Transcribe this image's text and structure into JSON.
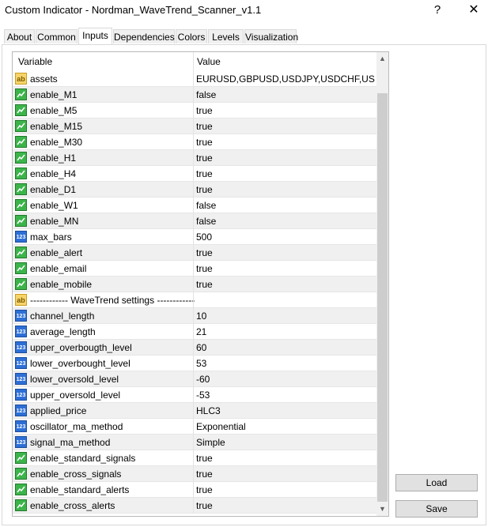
{
  "window": {
    "title": "Custom Indicator - Nordman_WaveTrend_Scanner_v1.1",
    "help_glyph": "?",
    "close_glyph": "✕"
  },
  "tabs": [
    "About",
    "Common",
    "Inputs",
    "Dependencies",
    "Colors",
    "Levels",
    "Visualization"
  ],
  "active_tab": "Inputs",
  "grid": {
    "header": {
      "variable": "Variable",
      "value": "Value"
    },
    "icon_labels": {
      "string": "ab",
      "number": "123"
    },
    "rows": [
      {
        "type": "string",
        "name": "assets",
        "value": "EURUSD,GBPUSD,USDJPY,USDCHF,USD..."
      },
      {
        "type": "bool",
        "name": "enable_M1",
        "value": "false"
      },
      {
        "type": "bool",
        "name": "enable_M5",
        "value": "true"
      },
      {
        "type": "bool",
        "name": "enable_M15",
        "value": "true"
      },
      {
        "type": "bool",
        "name": "enable_M30",
        "value": "true"
      },
      {
        "type": "bool",
        "name": "enable_H1",
        "value": "true"
      },
      {
        "type": "bool",
        "name": "enable_H4",
        "value": "true"
      },
      {
        "type": "bool",
        "name": "enable_D1",
        "value": "true"
      },
      {
        "type": "bool",
        "name": "enable_W1",
        "value": "false"
      },
      {
        "type": "bool",
        "name": "enable_MN",
        "value": "false"
      },
      {
        "type": "number",
        "name": "max_bars",
        "value": "500"
      },
      {
        "type": "bool",
        "name": "enable_alert",
        "value": "true"
      },
      {
        "type": "bool",
        "name": "enable_email",
        "value": "true"
      },
      {
        "type": "bool",
        "name": "enable_mobile",
        "value": "true"
      },
      {
        "type": "string",
        "name": "------------ WaveTrend settings ------------",
        "value": ""
      },
      {
        "type": "number",
        "name": "channel_length",
        "value": "10"
      },
      {
        "type": "number",
        "name": "average_length",
        "value": "21"
      },
      {
        "type": "number",
        "name": "upper_overbougth_level",
        "value": "60"
      },
      {
        "type": "number",
        "name": "lower_overbought_level",
        "value": "53"
      },
      {
        "type": "number",
        "name": "lower_oversold_level",
        "value": "-60"
      },
      {
        "type": "number",
        "name": "upper_oversold_level",
        "value": "-53"
      },
      {
        "type": "number",
        "name": "applied_price",
        "value": "HLC3"
      },
      {
        "type": "number",
        "name": "oscillator_ma_method",
        "value": "Exponential"
      },
      {
        "type": "number",
        "name": "signal_ma_method",
        "value": "Simple"
      },
      {
        "type": "bool",
        "name": "enable_standard_signals",
        "value": "true"
      },
      {
        "type": "bool",
        "name": "enable_cross_signals",
        "value": "true"
      },
      {
        "type": "bool",
        "name": "enable_standard_alerts",
        "value": "true"
      },
      {
        "type": "bool",
        "name": "enable_cross_alerts",
        "value": "true"
      }
    ]
  },
  "buttons": {
    "load": "Load",
    "save": "Save"
  },
  "colors": {
    "string_icon": "#f7d46a",
    "bool_icon": "#3cb44b",
    "number_icon": "#2d6fd6",
    "alt_row": "#f0f0f0"
  }
}
